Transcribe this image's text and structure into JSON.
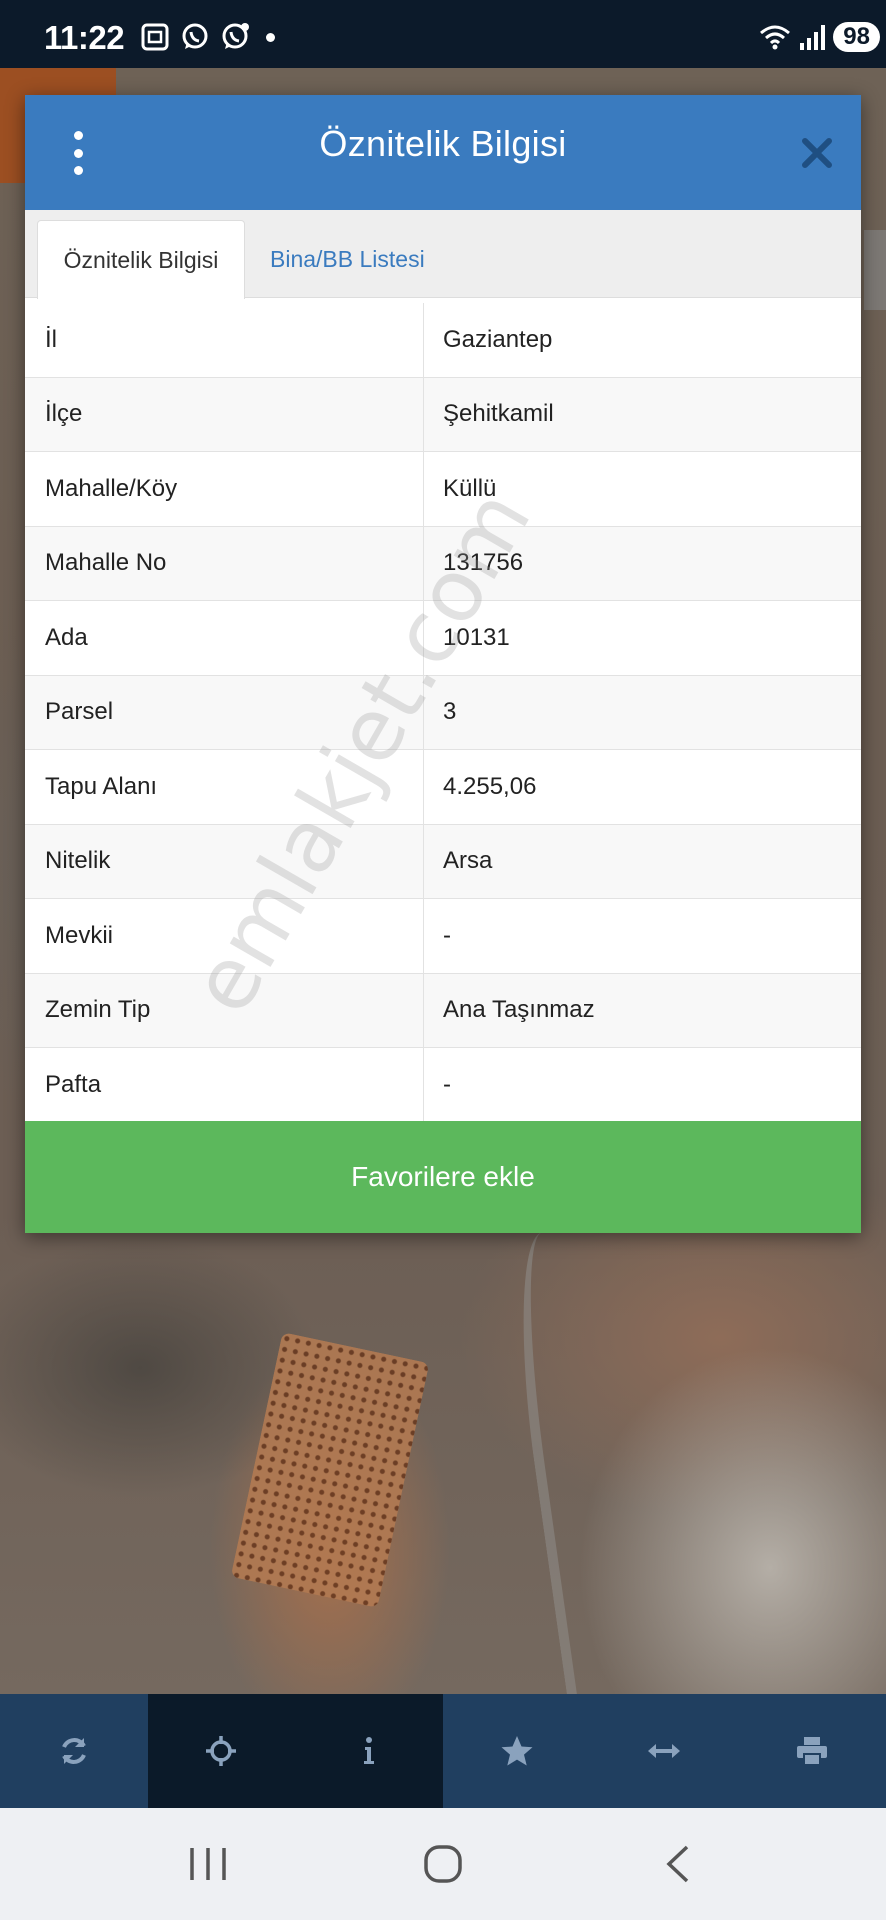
{
  "status_bar": {
    "time": "11:22",
    "battery": "98",
    "left_icons": [
      "screenshot-icon",
      "whatsapp-icon",
      "whatsapp-business-icon"
    ],
    "right_icons": [
      "wifi-icon",
      "signal-icon"
    ]
  },
  "dialog": {
    "title": "Öznitelik Bilgisi",
    "tabs": [
      {
        "label": "Öznitelik Bilgisi",
        "active": true
      },
      {
        "label": "Bina/BB Listesi",
        "active": false
      }
    ],
    "rows": [
      {
        "key": "İl",
        "value": "Gaziantep"
      },
      {
        "key": "İlçe",
        "value": "Şehitkamil"
      },
      {
        "key": "Mahalle/Köy",
        "value": "Küllü"
      },
      {
        "key": "Mahalle No",
        "value": "131756"
      },
      {
        "key": "Ada",
        "value": "10131"
      },
      {
        "key": "Parsel",
        "value": "3"
      },
      {
        "key": "Tapu Alanı",
        "value": "4.255,06"
      },
      {
        "key": "Nitelik",
        "value": "Arsa"
      },
      {
        "key": "Mevkii",
        "value": "-"
      },
      {
        "key": "Zemin Tip",
        "value": "Ana Taşınmaz"
      },
      {
        "key": "Pafta",
        "value": "-"
      }
    ],
    "favorite_button": "Favorilere ekle"
  },
  "watermark": "emlakjet.com",
  "toolbar": {
    "items": [
      "refresh-icon",
      "locate-icon",
      "info-icon",
      "star-icon",
      "measure-icon",
      "print-icon"
    ]
  },
  "colors": {
    "header": "#3a7bbf",
    "favorite": "#5cb85c",
    "toolbar": "#203f60",
    "toolbar_active": "#0b1a29"
  }
}
